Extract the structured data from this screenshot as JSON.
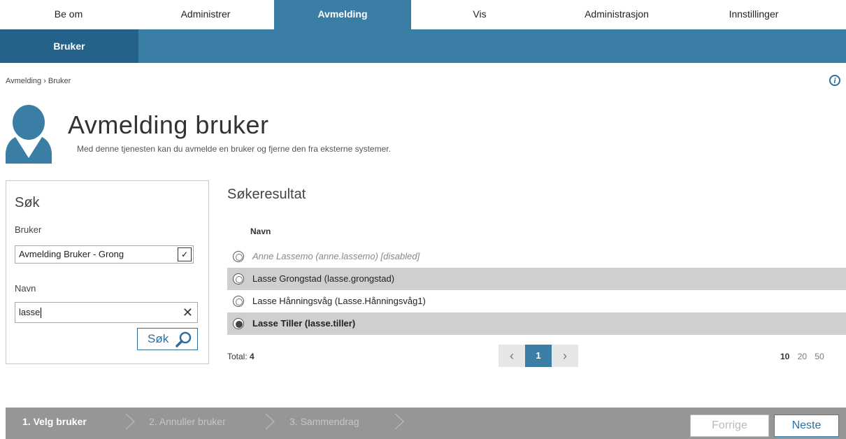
{
  "nav": {
    "tabs": [
      {
        "label": "Be om"
      },
      {
        "label": "Administrer"
      },
      {
        "label": "Avmelding"
      },
      {
        "label": "Vis"
      },
      {
        "label": "Administrasjon"
      },
      {
        "label": "Innstillinger"
      }
    ],
    "active_index": 2,
    "subtab": "Bruker"
  },
  "breadcrumb": "Avmelding › Bruker",
  "icons": {
    "info": "info-icon",
    "avatar": "user-avatar-icon",
    "search": "magnifier-icon",
    "clear": "close-icon",
    "dropdown": "chevron-down-icon"
  },
  "page": {
    "title": "Avmelding bruker",
    "subtitle": "Med denne tjenesten kan du avmelde en bruker og fjerne den fra eksterne systemer."
  },
  "search": {
    "title": "Søk",
    "user_label": "Bruker",
    "user_selected": "Avmelding Bruker - Grong",
    "name_label": "Navn",
    "name_value": "lasse",
    "button_label": "Søk"
  },
  "results": {
    "title": "Søkeresultat",
    "column_header": "Navn",
    "rows": [
      {
        "text": "Anne Lassemo (anne.lassemo) [disabled]",
        "state": "disabled"
      },
      {
        "text": "Lasse Grongstad (lasse.grongstad)",
        "state": "normal"
      },
      {
        "text": "Lasse Hånningsvåg (Lasse.Hånningsvåg1)",
        "state": "normal"
      },
      {
        "text": "Lasse Tiller (lasse.tiller)",
        "state": "selected"
      }
    ],
    "total_label": "Total:",
    "total_value": "4",
    "current_page": "1",
    "page_sizes": [
      "10",
      "20",
      "50"
    ],
    "active_page_size": "10"
  },
  "wizard": {
    "steps": [
      "1. Velg bruker",
      "2. Annuller bruker",
      "3. Sammendrag"
    ],
    "active_step": 0,
    "prev_label": "Forrige",
    "next_label": "Neste"
  },
  "colors": {
    "accent": "#3a7ea6",
    "accent_dark": "#24628a",
    "footer": "#969696",
    "row_alt": "#cfcfcf"
  }
}
